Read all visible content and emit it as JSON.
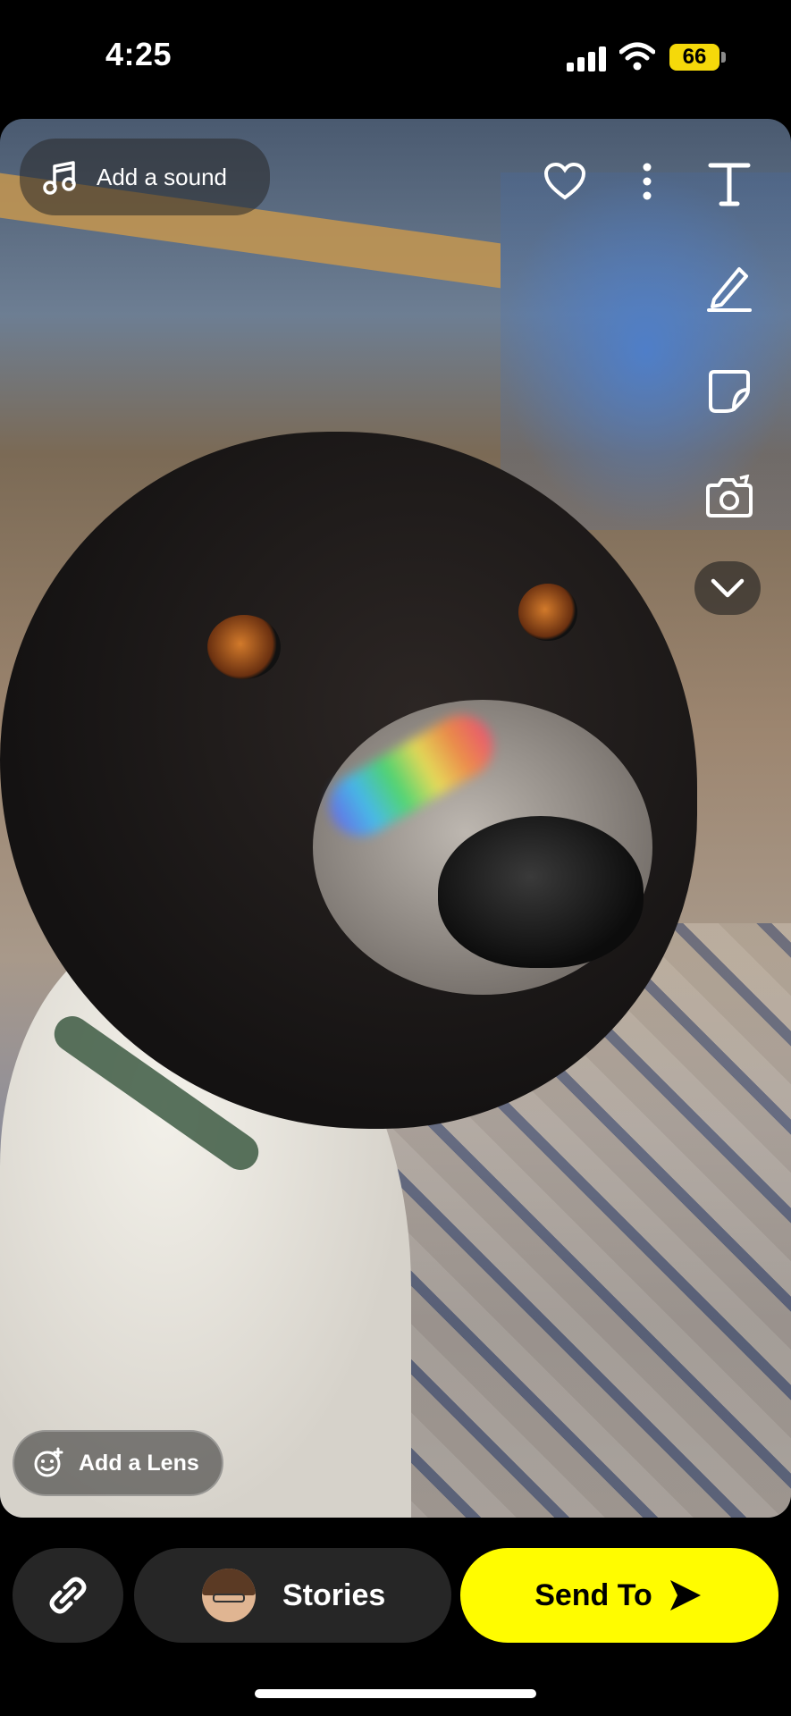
{
  "status_bar": {
    "time": "4:25",
    "battery": "66",
    "battery_color": "#f5d90a"
  },
  "editor": {
    "add_sound_label": "Add a sound",
    "add_lens_label": "Add a Lens",
    "tools": [
      "favorite-icon",
      "more-icon",
      "text-icon",
      "pen-icon",
      "sticker-icon",
      "camera-flip-icon",
      "chevron-down-icon"
    ]
  },
  "bottom_bar": {
    "stories_label": "Stories",
    "send_label": "Send To",
    "send_color": "#fffc00"
  }
}
